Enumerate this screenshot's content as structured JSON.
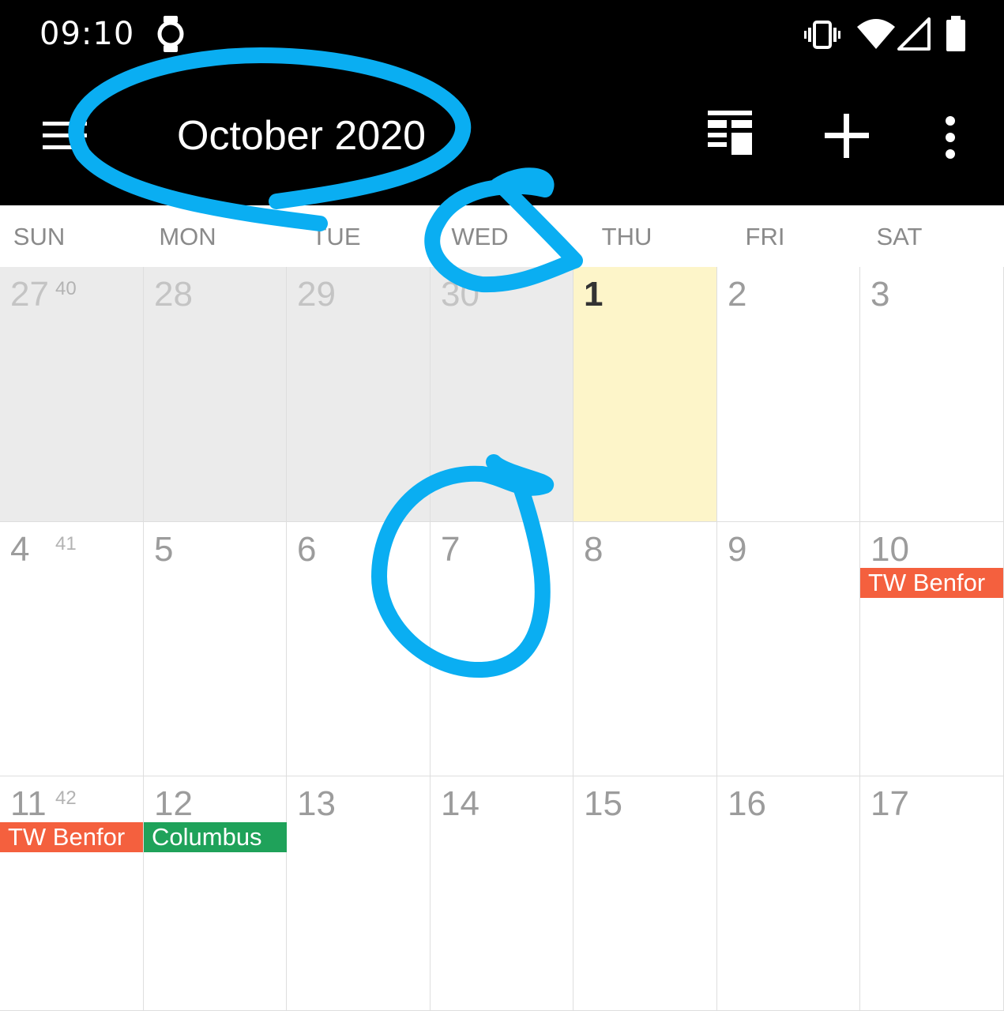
{
  "status_bar": {
    "time": "09:10",
    "icons": [
      "watch-icon",
      "vibrate-icon",
      "wifi-icon",
      "signal-icon",
      "battery-icon"
    ]
  },
  "app_bar": {
    "title": "October 2020",
    "icons": [
      "menu-icon",
      "view-switch-icon",
      "add-icon",
      "more-vert-icon"
    ]
  },
  "weekdays": [
    "SUN",
    "MON",
    "TUE",
    "WED",
    "THU",
    "FRI",
    "SAT"
  ],
  "weeks": [
    {
      "week_number": "40",
      "days": [
        {
          "num": "27",
          "state": "outside"
        },
        {
          "num": "28",
          "state": "outside"
        },
        {
          "num": "29",
          "state": "outside"
        },
        {
          "num": "30",
          "state": "outside"
        },
        {
          "num": "1",
          "state": "today"
        },
        {
          "num": "2",
          "state": "normal"
        },
        {
          "num": "3",
          "state": "normal"
        }
      ]
    },
    {
      "week_number": "41",
      "days": [
        {
          "num": "4",
          "state": "normal"
        },
        {
          "num": "5",
          "state": "normal"
        },
        {
          "num": "6",
          "state": "normal"
        },
        {
          "num": "7",
          "state": "normal"
        },
        {
          "num": "8",
          "state": "normal"
        },
        {
          "num": "9",
          "state": "normal"
        },
        {
          "num": "10",
          "state": "normal",
          "event": {
            "title": "TW Benfor",
            "color": "#f4603e"
          }
        }
      ]
    },
    {
      "week_number": "42",
      "days": [
        {
          "num": "11",
          "state": "normal",
          "event": {
            "title": "TW Benfor",
            "color": "#f4603e"
          }
        },
        {
          "num": "12",
          "state": "normal",
          "event": {
            "title": "Columbus",
            "color": "#1fa25a"
          }
        },
        {
          "num": "13",
          "state": "normal"
        },
        {
          "num": "14",
          "state": "normal"
        },
        {
          "num": "15",
          "state": "normal"
        },
        {
          "num": "16",
          "state": "normal"
        },
        {
          "num": "17",
          "state": "normal"
        }
      ]
    }
  ],
  "colors": {
    "app_bar_bg": "#000000",
    "today_bg": "#fdf5c9",
    "outside_bg": "#ebebeb",
    "annotation": "#0aaef2"
  }
}
